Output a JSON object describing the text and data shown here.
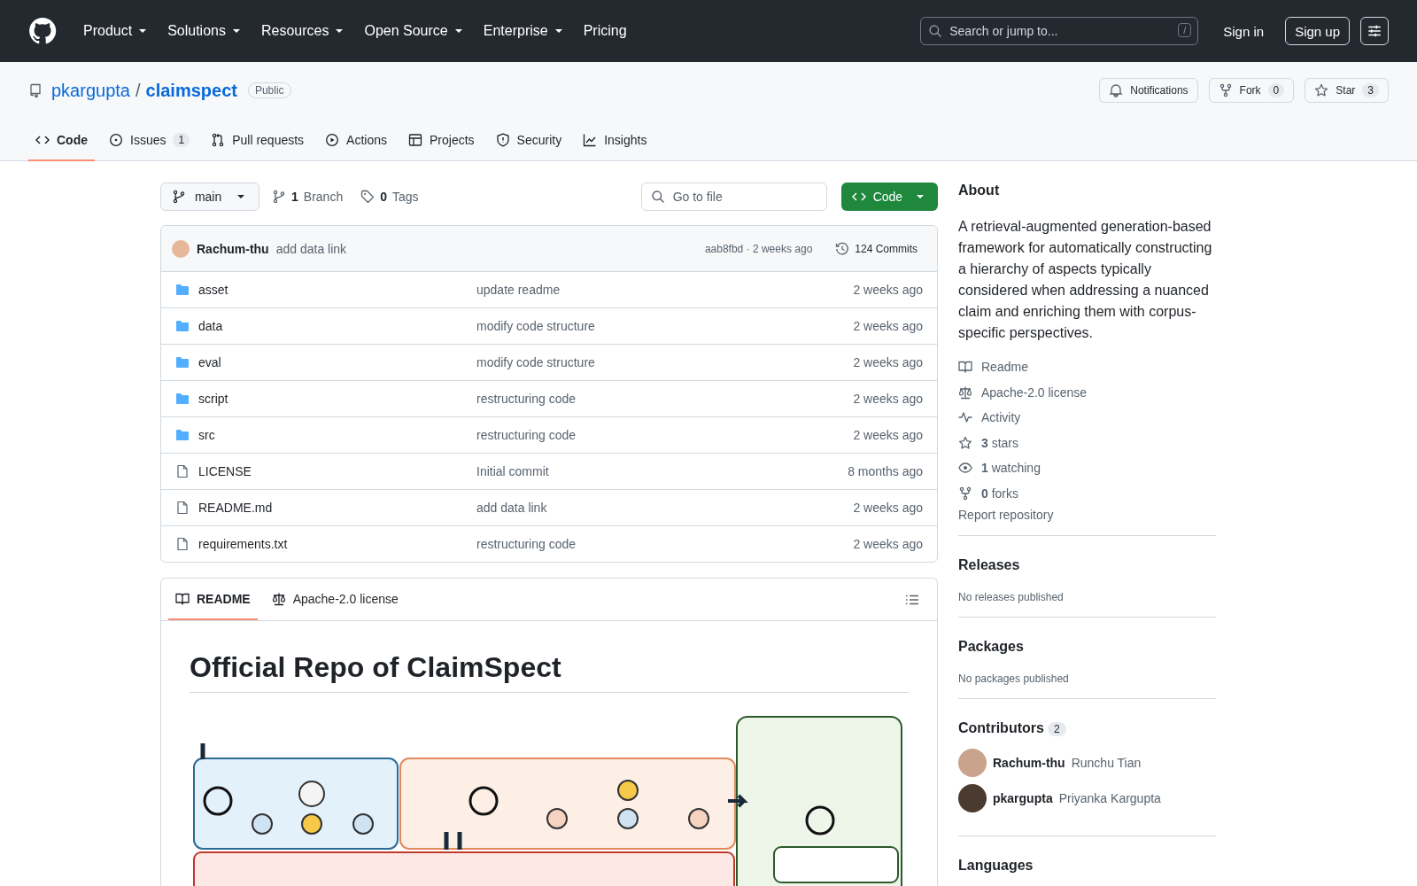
{
  "header": {
    "nav": [
      {
        "label": "Product",
        "dropdown": true
      },
      {
        "label": "Solutions",
        "dropdown": true
      },
      {
        "label": "Resources",
        "dropdown": true
      },
      {
        "label": "Open Source",
        "dropdown": true
      },
      {
        "label": "Enterprise",
        "dropdown": true
      },
      {
        "label": "Pricing",
        "dropdown": false
      }
    ],
    "search": {
      "placeholder": "Search or jump to...",
      "shortcut": "/"
    },
    "sign_in": "Sign in",
    "sign_up": "Sign up"
  },
  "repo": {
    "owner": "pkargupta",
    "separator": "/",
    "name": "claimspect",
    "visibility": "Public",
    "actions": [
      {
        "kind": "bell",
        "label": "Notifications"
      },
      {
        "kind": "fork",
        "label": "Fork",
        "count": "0"
      },
      {
        "kind": "star",
        "label": "Star",
        "count": "3"
      }
    ]
  },
  "tabs": [
    {
      "kind": "code",
      "label": "Code",
      "selected": true
    },
    {
      "kind": "issue",
      "label": "Issues",
      "count": "1",
      "selected": false
    },
    {
      "kind": "pull",
      "label": "Pull requests",
      "selected": false
    },
    {
      "kind": "play",
      "label": "Actions",
      "selected": false
    },
    {
      "kind": "table",
      "label": "Projects",
      "selected": false
    },
    {
      "kind": "shield",
      "label": "Security",
      "selected": false
    },
    {
      "kind": "graph",
      "label": "Insights",
      "selected": false
    }
  ],
  "toolbar": {
    "branch": "main",
    "branches": {
      "count": "1",
      "label": "Branch"
    },
    "tags": {
      "count": "0",
      "label": "Tags"
    },
    "go_to_file": {
      "placeholder": "Go to file"
    },
    "code_button": "Code"
  },
  "latest_commit": {
    "author": "Rachum-thu",
    "message": "add data link",
    "meta": "aab8fbd · 2 weeks ago",
    "commits": "124 Commits"
  },
  "files": [
    {
      "kind": "folder",
      "name": "asset",
      "message": "update readme",
      "time": "2 weeks ago"
    },
    {
      "kind": "folder",
      "name": "data",
      "message": "modify code structure",
      "time": "2 weeks ago"
    },
    {
      "kind": "folder",
      "name": "eval",
      "message": "modify code structure",
      "time": "2 weeks ago"
    },
    {
      "kind": "folder",
      "name": "script",
      "message": "restructuring code",
      "time": "2 weeks ago"
    },
    {
      "kind": "folder",
      "name": "src",
      "message": "restructuring code",
      "time": "2 weeks ago"
    },
    {
      "kind": "file",
      "name": "LICENSE",
      "message": "Initial commit",
      "time": "8 months ago"
    },
    {
      "kind": "file",
      "name": "README.md",
      "message": "add data link",
      "time": "2 weeks ago"
    },
    {
      "kind": "file",
      "name": "requirements.txt",
      "message": "restructuring code",
      "time": "2 weeks ago"
    }
  ],
  "readme": {
    "tabs": [
      {
        "kind": "book",
        "label": "README",
        "selected": true
      },
      {
        "kind": "law",
        "label": "Apache-2.0 license",
        "selected": false
      }
    ],
    "heading": "Official Repo of ClaimSpect"
  },
  "about": {
    "title": "About",
    "description": "A retrieval-augmented generation-based framework for automatically constructing a hierarchy of aspects typically considered when addressing a nuanced claim and enriching them with corpus-specific perspectives.",
    "links": [
      {
        "kind": "book",
        "text": "Readme"
      },
      {
        "kind": "law",
        "text": "Apache-2.0 license"
      },
      {
        "kind": "pulse",
        "text": "Activity"
      },
      {
        "kind": "star",
        "text": "**3** stars"
      },
      {
        "kind": "eye",
        "text": "**1** watching"
      },
      {
        "kind": "fork",
        "text": "**0** forks"
      }
    ],
    "report": "Report repository"
  },
  "releases": {
    "title": "Releases",
    "note": "No releases published"
  },
  "packages": {
    "title": "Packages",
    "note": "No packages published"
  },
  "contributors": {
    "title": "Contributors",
    "count": "2",
    "people": [
      {
        "login": "Rachum-thu",
        "name": "Runchu Tian"
      },
      {
        "login": "pkargupta",
        "name": "Priyanka Kargupta"
      }
    ]
  },
  "languages": {
    "title": "Languages"
  }
}
